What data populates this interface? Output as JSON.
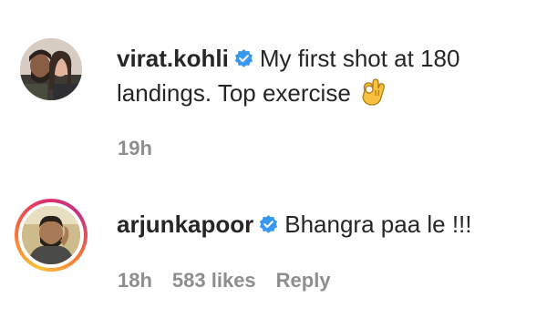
{
  "comments": [
    {
      "username": "virat.kohli",
      "verified": true,
      "text_line1": "My first shot at 180",
      "text_line2": "landings. Top exercise",
      "emoji": "ok-hand-emoji",
      "time": "19h"
    },
    {
      "username": "arjunkapoor",
      "verified": true,
      "text": "Bhangra paa le !!!",
      "time": "18h",
      "likes": "583 likes",
      "reply_label": "Reply"
    }
  ],
  "colors": {
    "verified": "#3897f0",
    "meta_text": "#8e8e8e",
    "primary_text": "#262626"
  }
}
